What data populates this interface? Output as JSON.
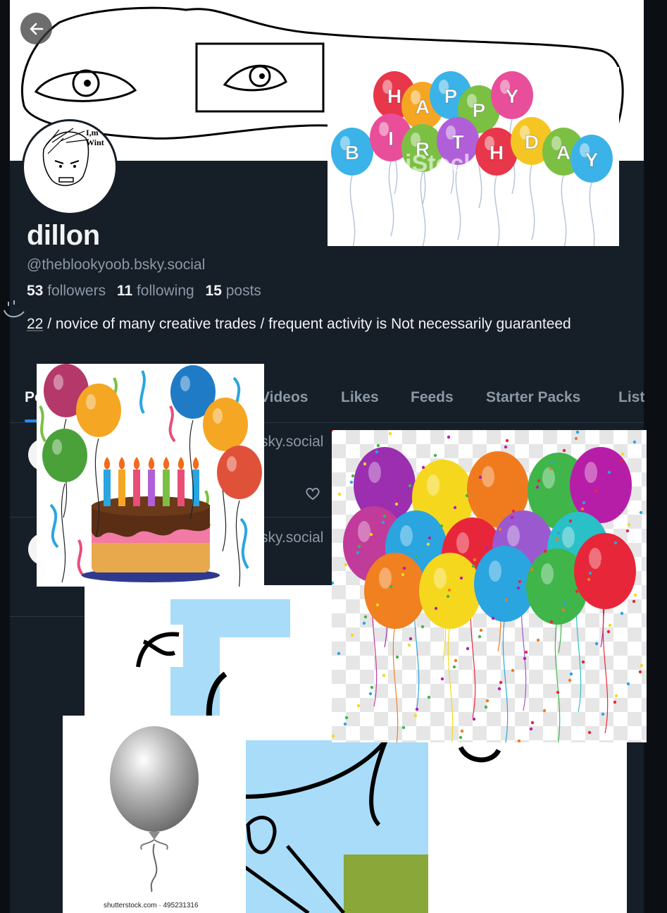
{
  "profile": {
    "display_name": "dillon",
    "handle": "@theblookyoob.bsky.social",
    "followers_count": "53",
    "followers_label": "followers",
    "following_count": "11",
    "following_label": "following",
    "posts_count": "15",
    "posts_label": "posts",
    "bio_number": "22",
    "bio_text": " / novice of many creative trades / frequent activity is Not necessarily guaranteed",
    "avatar_caption_1": "I,m",
    "avatar_caption_2": "Wint"
  },
  "tabs": [
    {
      "label": "Po"
    },
    {
      "label": "Videos"
    },
    {
      "label": "Likes"
    },
    {
      "label": "Feeds"
    },
    {
      "label": "Starter Packs"
    },
    {
      "label": "List"
    }
  ],
  "posts": [
    {
      "handle_fragment": "sky.social"
    },
    {
      "handle_fragment": "sky.social"
    }
  ],
  "overlays": {
    "happy_birthday_letters": [
      "H",
      "A",
      "P",
      "P",
      "Y",
      "B",
      "I",
      "R",
      "T",
      "H",
      "D",
      "A",
      "Y"
    ],
    "stock_watermark": "iStock",
    "stock_caption": "shutterstock.com · 495231316"
  },
  "colors": {
    "background": "#161e27",
    "accent": "#208bfe",
    "muted_text": "#8b98a5"
  }
}
